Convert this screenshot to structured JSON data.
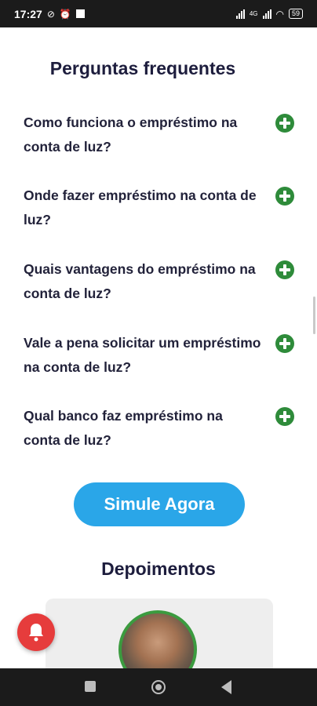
{
  "status_bar": {
    "time": "17:27",
    "network": "4G",
    "battery": "59"
  },
  "faq": {
    "title": "Perguntas frequentes",
    "items": [
      {
        "question": "Como funciona o empréstimo na conta de luz?"
      },
      {
        "question": "Onde fazer empréstimo na conta de luz?"
      },
      {
        "question": "Quais vantagens do empréstimo na conta de luz?"
      },
      {
        "question": "Vale a pena solicitar um empréstimo na conta de luz?"
      },
      {
        "question": "Qual banco faz empréstimo na conta de luz?"
      }
    ]
  },
  "cta": {
    "label": "Simule Agora"
  },
  "testimonials": {
    "title": "Depoimentos"
  },
  "colors": {
    "accent_blue": "#2aa6e8",
    "plus_green": "#2e8b3a",
    "bell_red": "#e63c3c",
    "title_navy": "#1d1d3d"
  }
}
